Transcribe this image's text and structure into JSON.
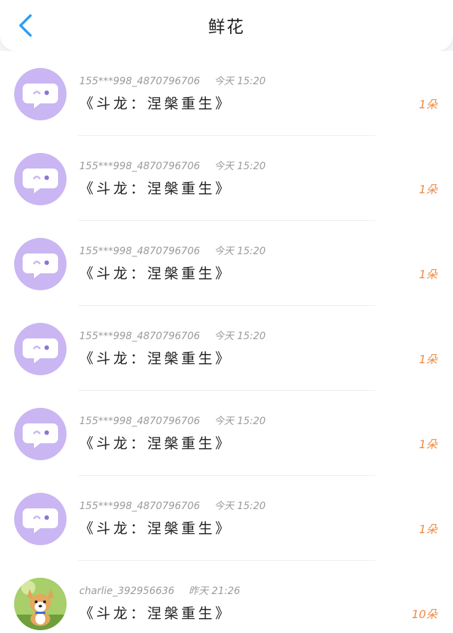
{
  "header": {
    "title": "鲜花",
    "back_icon": "chevron-left-icon",
    "accent_color": "#2f9cf0"
  },
  "items": [
    {
      "user": "155***998_4870796706",
      "time": "今天 15:20",
      "content": "《斗龙：涅槃重生》",
      "amount": "1朵",
      "avatar": "default-chat-avatar"
    },
    {
      "user": "155***998_4870796706",
      "time": "今天 15:20",
      "content": "《斗龙：涅槃重生》",
      "amount": "1朵",
      "avatar": "default-chat-avatar"
    },
    {
      "user": "155***998_4870796706",
      "time": "今天 15:20",
      "content": "《斗龙：涅槃重生》",
      "amount": "1朵",
      "avatar": "default-chat-avatar"
    },
    {
      "user": "155***998_4870796706",
      "time": "今天 15:20",
      "content": "《斗龙：涅槃重生》",
      "amount": "1朵",
      "avatar": "default-chat-avatar"
    },
    {
      "user": "155***998_4870796706",
      "time": "今天 15:20",
      "content": "《斗龙：涅槃重生》",
      "amount": "1朵",
      "avatar": "default-chat-avatar"
    },
    {
      "user": "155***998_4870796706",
      "time": "今天 15:20",
      "content": "《斗龙：涅槃重生》",
      "amount": "1朵",
      "avatar": "default-chat-avatar"
    },
    {
      "user": "charlie_392956636",
      "time": "昨天 21:26",
      "content": "《斗龙：涅槃重生》",
      "amount": "10朵",
      "avatar": "corgi-photo-avatar"
    }
  ],
  "colors": {
    "avatar_bg": "#c9b6f2",
    "amount": "#ee8a43"
  }
}
